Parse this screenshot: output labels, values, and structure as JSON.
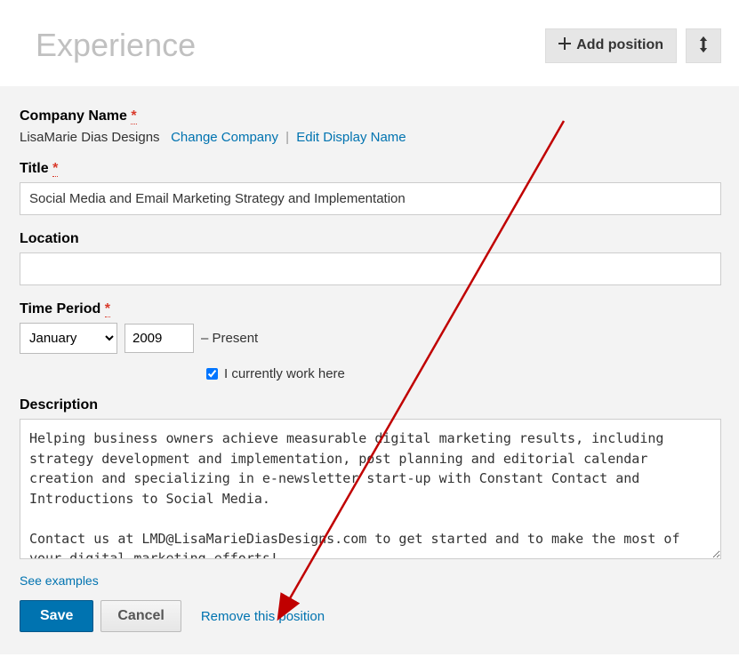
{
  "header": {
    "title": "Experience",
    "add_position_label": "Add position"
  },
  "company": {
    "label": "Company Name",
    "value": "LisaMarie Dias Designs",
    "change_link": "Change Company",
    "edit_display_link": "Edit Display Name"
  },
  "title_field": {
    "label": "Title",
    "value": "Social Media and Email Marketing Strategy and Implementation"
  },
  "location": {
    "label": "Location",
    "value": ""
  },
  "time_period": {
    "label": "Time Period",
    "month": "January",
    "year": "2009",
    "present_text": "– Present",
    "checkbox_label": "I currently work here",
    "currently_works": true
  },
  "description": {
    "label": "Description",
    "value": "Helping business owners achieve measurable digital marketing results, including strategy development and implementation, post planning and editorial calendar creation and specializing in e-newsletter start-up with Constant Contact and Introductions to Social Media.\n\nContact us at LMD@LisaMarieDiasDesigns.com to get started and to make the most of your digital marketing efforts!"
  },
  "links": {
    "see_examples": "See examples",
    "remove": "Remove this position"
  },
  "buttons": {
    "save": "Save",
    "cancel": "Cancel"
  }
}
